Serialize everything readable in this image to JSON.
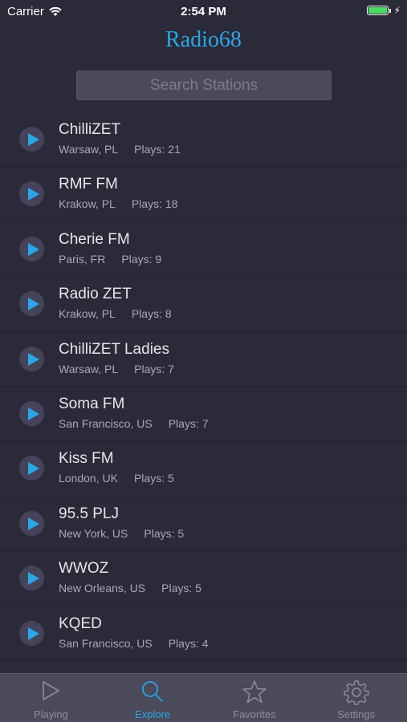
{
  "status_bar": {
    "carrier": "Carrier",
    "time": "2:54 PM"
  },
  "header": {
    "title": "Radio68"
  },
  "search": {
    "placeholder": "Search Stations"
  },
  "stations": [
    {
      "name": "ChilliZET",
      "location": "Warsaw, PL",
      "plays": "Plays: 21"
    },
    {
      "name": "RMF FM",
      "location": "Krakow, PL",
      "plays": "Plays: 18"
    },
    {
      "name": "Cherie FM",
      "location": "Paris, FR",
      "plays": "Plays: 9"
    },
    {
      "name": "Radio ZET",
      "location": "Krakow, PL",
      "plays": "Plays: 8"
    },
    {
      "name": "ChilliZET Ladies",
      "location": "Warsaw, PL",
      "plays": "Plays: 7"
    },
    {
      "name": "Soma FM",
      "location": "San Francisco, US",
      "plays": "Plays: 7"
    },
    {
      "name": "Kiss FM",
      "location": "London, UK",
      "plays": "Plays: 5"
    },
    {
      "name": "95.5 PLJ",
      "location": "New York, US",
      "plays": "Plays: 5"
    },
    {
      "name": "WWOZ",
      "location": "New Orleans, US",
      "plays": "Plays: 5"
    },
    {
      "name": "KQED",
      "location": "San Francisco, US",
      "plays": "Plays: 4"
    }
  ],
  "tabs": [
    {
      "label": "Playing",
      "icon": "play-icon"
    },
    {
      "label": "Explore",
      "icon": "search-icon"
    },
    {
      "label": "Favorites",
      "icon": "star-icon"
    },
    {
      "label": "Settings",
      "icon": "gear-icon"
    }
  ],
  "colors": {
    "accent": "#2aa7e6",
    "background": "#2b2a38",
    "tabbar": "#4b4a5a"
  }
}
